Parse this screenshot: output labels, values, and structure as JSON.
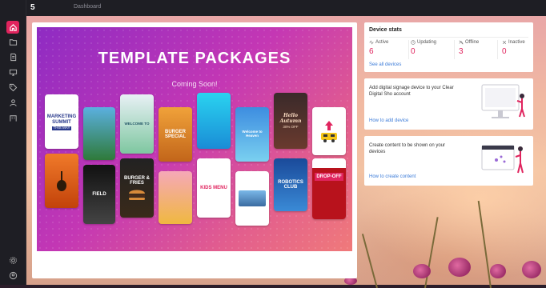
{
  "topbar": {
    "title": "Dashboard",
    "logo_text": "5"
  },
  "banner": {
    "title": "TEMPLATE PACKAGES",
    "subtitle": "Coming Soon!",
    "tiles": [
      {
        "title": "MARKETING SUMMIT",
        "sub": "THIS MAY"
      },
      {
        "title": "",
        "sub": ""
      },
      {
        "title": "WELCOME TO",
        "sub": ""
      },
      {
        "title": "BURGER SPECIAL",
        "sub": ""
      },
      {
        "title": "",
        "sub": ""
      },
      {
        "title": "Welcome to Heaven",
        "sub": ""
      },
      {
        "title": "Hello Autumn",
        "sub": "30% OFF"
      },
      {
        "title": "",
        "sub": ""
      },
      {
        "title": "",
        "sub": ""
      },
      {
        "title": "FIELD",
        "sub": ""
      },
      {
        "title": "BURGER & FRIES",
        "sub": ""
      },
      {
        "title": "",
        "sub": ""
      },
      {
        "title": "KIDS MENU",
        "sub": ""
      },
      {
        "title": "",
        "sub": ""
      },
      {
        "title": "ROBOTICS CLUB",
        "sub": ""
      },
      {
        "title": "DROP-OFF",
        "sub": ""
      },
      {
        "title": "",
        "sub": ""
      }
    ]
  },
  "device_stats": {
    "title": "Device stats",
    "stats": [
      {
        "label": "Active",
        "value": "6",
        "icon": "activity-icon"
      },
      {
        "label": "Updating",
        "value": "0",
        "icon": "clock-icon"
      },
      {
        "label": "Offline",
        "value": "3",
        "icon": "offline-icon"
      },
      {
        "label": "Inactive",
        "value": "0",
        "icon": "close-icon"
      }
    ],
    "link": "See all devices"
  },
  "add_device": {
    "text": "Add digital signage device to your Clear Digital Sho account",
    "link": "How to add device"
  },
  "create_content": {
    "text": "Create content to be shown on your devices",
    "link": "How to create content"
  },
  "colors": {
    "accent": "#e0245e",
    "link": "#3b7bd8",
    "sidebar": "#1e1e24"
  }
}
